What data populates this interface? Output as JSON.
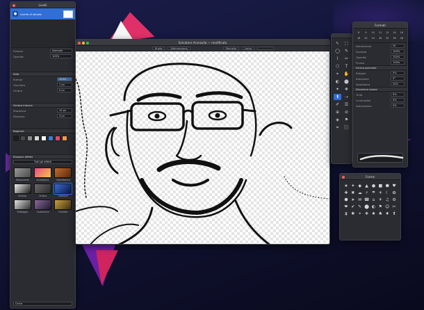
{
  "desktop": {
    "background": "#13163a"
  },
  "canvas_window": {
    "title": "Salvatore Aranzulla — modificato",
    "toolbar": [
      "Ruota",
      "Ridimensiona",
      "Pennello",
      "Lama"
    ],
    "colors": {
      "checker_light": "#ffffff",
      "checker_dark": "#e4e4e4"
    }
  },
  "layers_panel": {
    "title": "Livelli",
    "layer": {
      "name": "Livello di sfondo",
      "sub": "Immagine"
    },
    "rows": [
      {
        "label": "Fusione",
        "value": "Normale"
      },
      {
        "label": "Opacità",
        "value": "100%"
      }
    ],
    "style_head": "Stile",
    "style_rows": [
      {
        "label": "Riempi",
        "value": "100%"
      },
      {
        "label": "Tracciato",
        "value": "1 px"
      },
      {
        "label": "Ombra",
        "value": "0 px"
      }
    ],
    "shadow_head": "Ombra interna",
    "shadow_rows": [
      {
        "label": "Sfocatura",
        "value": "10 px"
      },
      {
        "label": "Distanza",
        "value": "3 px"
      }
    ],
    "glow_head": "Bagliore",
    "swatches": [
      "#1d1d1d",
      "#4a4a4a",
      "#8a8a8a",
      "#d8d8d8",
      "#ffffff",
      "#3a7bd5",
      "#e04a6a",
      "#f2994a"
    ],
    "effects_head": "Browser effetti",
    "effects_category": "Tutti gli effetti",
    "effects": [
      {
        "label": "Monocromo",
        "c1": "#9a9a9a",
        "c2": "#4a4a4a"
      },
      {
        "label": "Arcobaleno",
        "c1": "#e84a8a",
        "c2": "#f5c542"
      },
      {
        "label": "Vignettatura",
        "c1": "#c26a2a",
        "c2": "#5a2a10"
      },
      {
        "label": "Schizzo",
        "c1": "#f0f0f0",
        "c2": "#1a1a1a"
      },
      {
        "label": "Ombra",
        "c1": "#6a6a6a",
        "c2": "#2a2a2a"
      },
      {
        "label": "Contorni",
        "c1": "#3a6ad5",
        "c2": "#0a1a40"
      },
      {
        "label": "Tratteggio",
        "c1": "#e0e0e0",
        "c2": "#303030"
      },
      {
        "label": "Carboncino",
        "c1": "#8a6a9a",
        "c2": "#201a30"
      },
      {
        "label": "Fumetto",
        "c1": "#c8a040",
        "c2": "#403010"
      }
    ],
    "footer": "Cerca"
  },
  "tools_panel": {
    "tools": [
      "↖",
      "⬚",
      "◯",
      "✎",
      "⌇",
      "✂",
      "⬡",
      "T",
      "⌖",
      "✋",
      "◐",
      "⬤",
      "✦",
      "❖",
      "⬆",
      "⇢",
      "✐",
      "☰",
      "⊕",
      "⊘",
      "◈",
      "⚑",
      "⌗",
      "⬛"
    ]
  },
  "format_panel": {
    "title": "Formati",
    "grid": [
      "8",
      "9",
      "10",
      "11",
      "12",
      "14",
      "16",
      "18",
      "20",
      "24",
      "28",
      "32",
      "36",
      "48"
    ],
    "rows": [
      {
        "label": "Dimensione",
        "value": "50"
      },
      {
        "label": "Durezza",
        "value": "100%"
      },
      {
        "label": "Opacità",
        "value": "100%"
      },
      {
        "label": "Flusso",
        "value": "100%"
      }
    ],
    "head2": "Forma pennello",
    "rows2": [
      {
        "label": "Ritaglio",
        "value": "0%"
      },
      {
        "label": "Rotazione",
        "value": "0°"
      },
      {
        "label": "Spaziatura",
        "value": "25%"
      }
    ],
    "head3": "Dinamica colore",
    "rows3": [
      {
        "label": "Tinta",
        "value": "0%"
      },
      {
        "label": "Luminosità",
        "value": "0%"
      },
      {
        "label": "Saturazione",
        "value": "0%"
      }
    ]
  },
  "shapes_panel": {
    "title": "Forme",
    "shapes": [
      "★",
      "✦",
      "◆",
      "▲",
      "●",
      "■",
      "⬟",
      "♥",
      "✚",
      "✖",
      "☁",
      "⚡",
      "☂",
      "☀",
      "☾",
      "✿",
      "⬢",
      "➤",
      "✉",
      "☎",
      "⌂",
      "✈",
      "♫",
      "⚙",
      "❤",
      "✔",
      "✎",
      "⬤",
      "◐",
      "⚑",
      "☺",
      "✂",
      "⧗",
      "✱",
      "⌖",
      "❖",
      "♠",
      "♣",
      "♦",
      "⬆"
    ]
  }
}
